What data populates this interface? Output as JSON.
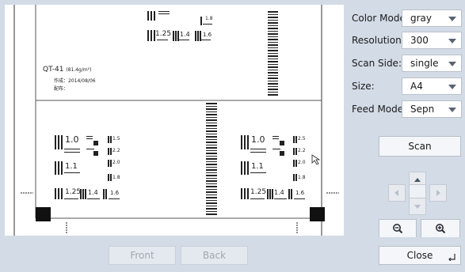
{
  "preview": {
    "doc_title": "QT-41",
    "doc_weight": "(81.4g/m²)",
    "doc_date_line": "作成：2014/08/06",
    "doc_dist_line": "配布：",
    "test_labels": [
      "1.8",
      "1.25",
      "1.4",
      "1.6",
      "1.0",
      "1.1",
      "1.8",
      "1.25",
      "1.4",
      "1.6",
      "1.0",
      "1.1",
      "1.8",
      "1.25",
      "1.4",
      "1.6"
    ],
    "small_labels": [
      "1.5",
      "2.2",
      "2.0",
      "2.5",
      "2.2",
      "2.0"
    ]
  },
  "settings": [
    {
      "label": "Color Mode:",
      "value": "gray"
    },
    {
      "label": "Resolution:",
      "value": "300"
    },
    {
      "label": "Scan Side:",
      "value": "single"
    },
    {
      "label": "Size:",
      "value": "A4"
    },
    {
      "label": "Feed Mode:",
      "value": "Sepn"
    }
  ],
  "buttons": {
    "scan": "Scan",
    "front": "Front",
    "back": "Back",
    "close": "Close"
  },
  "colors": {
    "background": "#d3dbe6",
    "button": "#f4f6f9",
    "disabled_text": "#a0a7b1"
  }
}
